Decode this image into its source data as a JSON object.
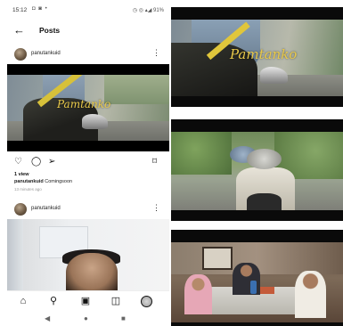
{
  "status_bar": {
    "time": "15:12",
    "left_icons": "◘ ◙ •",
    "right_icons": "◷ ◎ ▴◢ 91%"
  },
  "header": {
    "title": "Posts"
  },
  "posts": [
    {
      "username": "panutankuid",
      "video_title": "Pamtanko",
      "views": "1 view",
      "caption_user": "panutankuid",
      "caption_text": "Comingsoon",
      "time": "13 minutes ago"
    },
    {
      "username": "panutankuid"
    }
  ],
  "icons": {
    "back": "back-arrow-icon",
    "more": "more-vertical-icon",
    "like": "heart-icon",
    "comment": "comment-icon",
    "share": "send-icon",
    "save": "bookmark-icon",
    "nav_home": "home-icon",
    "nav_search": "search-icon",
    "nav_reels": "reels-icon",
    "nav_shop": "shop-icon",
    "nav_profile": "profile-avatar-icon",
    "sys_back": "triangle-back-icon",
    "sys_home": "circle-home-icon",
    "sys_recent": "square-recent-icon"
  },
  "stills": [
    {
      "title_overlay": "Pamtanko"
    },
    {
      "title_overlay": ""
    },
    {
      "title_overlay": ""
    }
  ],
  "colors": {
    "title_overlay": "#e9c94a",
    "letterbox": "#000000"
  }
}
